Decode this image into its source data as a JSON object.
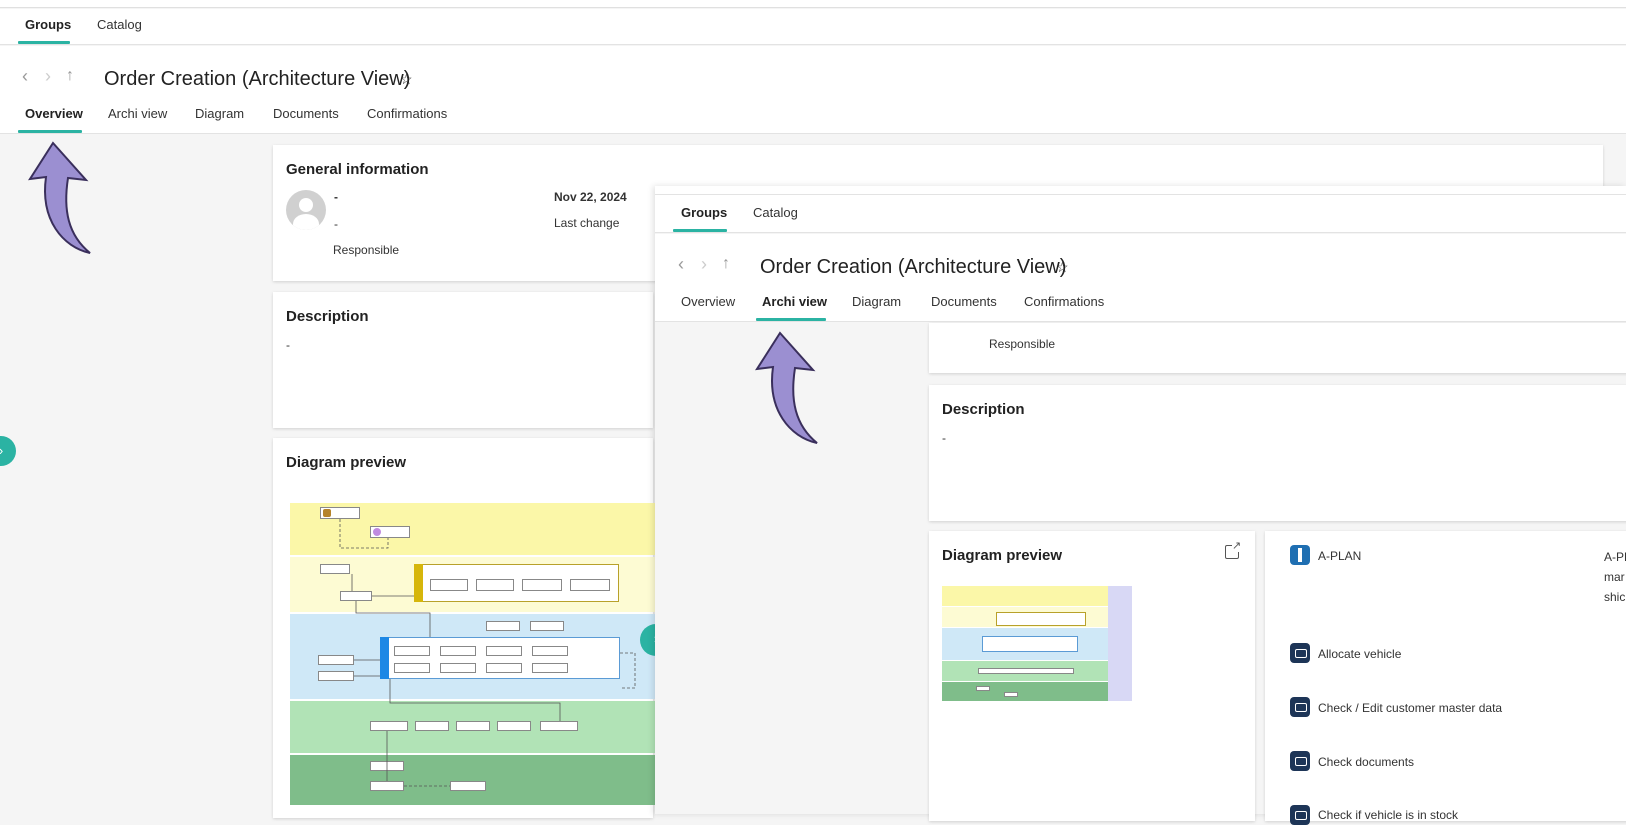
{
  "back": {
    "tabs": [
      "Groups",
      "Catalog"
    ],
    "title": "Order Creation (Architecture View)",
    "star": "☆",
    "subtabs": [
      "Overview",
      "Archi view",
      "Diagram",
      "Documents",
      "Confirmations"
    ],
    "general": {
      "title": "General information",
      "name": "-",
      "role_dash": "-",
      "responsible_label": "Responsible",
      "date": "Nov 22, 2024",
      "date_label": "Last change"
    },
    "description": {
      "title": "Description",
      "text": "-"
    },
    "diagram": {
      "title": "Diagram preview"
    }
  },
  "front": {
    "tabs": [
      "Groups",
      "Catalog"
    ],
    "title": "Order Creation (Architecture View)",
    "star": "☆",
    "subtabs": [
      "Overview",
      "Archi view",
      "Diagram",
      "Documents",
      "Confirmations"
    ],
    "responsible_label": "Responsible",
    "description": {
      "title": "Description",
      "text": "-"
    },
    "diagram": {
      "title": "Diagram preview"
    },
    "items": [
      {
        "label": "A-PLAN",
        "icon": "a-plan-icon"
      },
      {
        "label": "Allocate vehicle",
        "icon": "application-icon"
      },
      {
        "label": "Check / Edit customer master data",
        "icon": "application-icon"
      },
      {
        "label": "Check documents",
        "icon": "application-icon"
      },
      {
        "label": "Check if vehicle is in stock",
        "icon": "application-icon"
      }
    ],
    "side_text": [
      "A-PL",
      "mar",
      "shic"
    ]
  },
  "colors": {
    "accent": "#2bb3a3",
    "arrow": "#9b8fd1",
    "lane_yellow": "#fbf7a8",
    "lane_light_yellow": "#fdfbd3",
    "lane_blue": "#cfe8f7",
    "lane_green": "#b1e3b6",
    "lane_dark_green": "#7fbd8a"
  }
}
